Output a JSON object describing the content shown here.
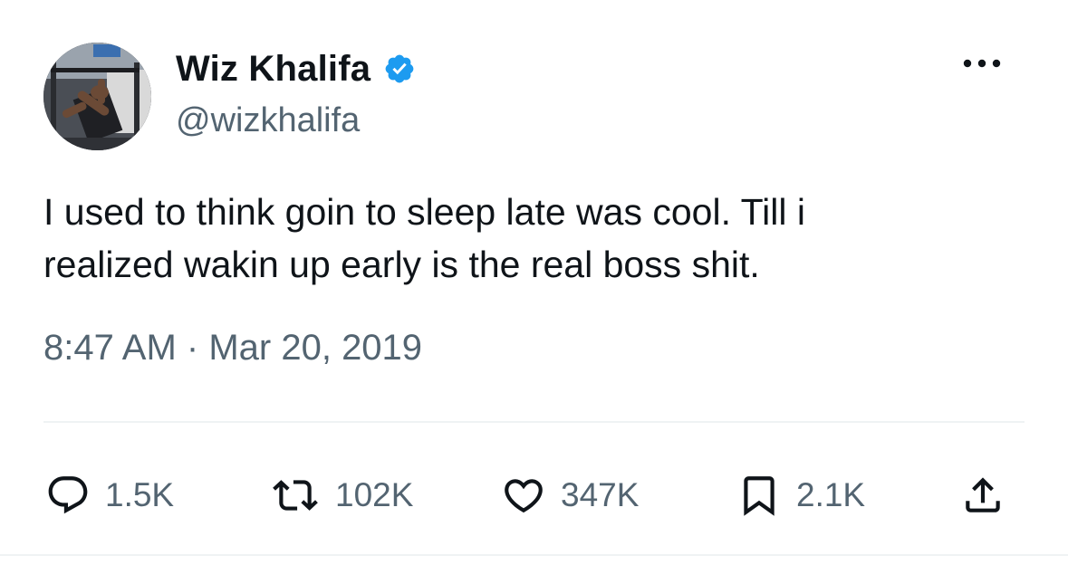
{
  "author": {
    "display_name": "Wiz Khalifa",
    "handle": "@wizkhalifa",
    "verified": true
  },
  "tweet": {
    "text_lines": [
      "I used to think goin to sleep late was cool. Till i",
      "realized wakin up early is the real boss shit."
    ],
    "time": "8:47 AM",
    "separator": "·",
    "date": "Mar 20, 2019"
  },
  "actions": {
    "reply": {
      "icon": "reply-icon",
      "count": "1.5K"
    },
    "retweet": {
      "icon": "retweet-icon",
      "count": "102K"
    },
    "like": {
      "icon": "heart-icon",
      "count": "347K"
    },
    "bookmark": {
      "icon": "bookmark-icon",
      "count": "2.1K"
    },
    "share": {
      "icon": "share-icon"
    }
  },
  "colors": {
    "text_primary": "#0f1419",
    "text_secondary": "#536471",
    "verified_blue": "#1d9bf0",
    "divider": "#eff3f4"
  }
}
